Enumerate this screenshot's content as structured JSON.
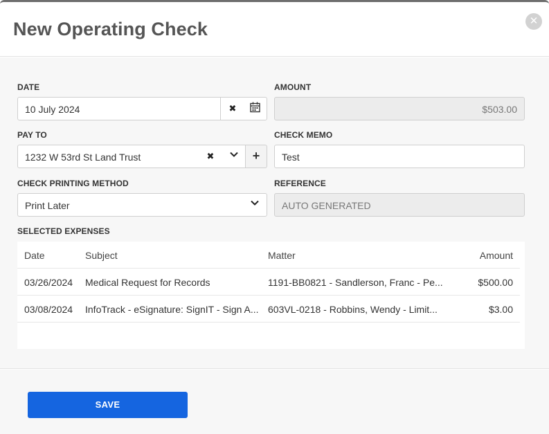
{
  "modal": {
    "title": "New Operating Check",
    "close_icon": "close-icon"
  },
  "form": {
    "date": {
      "label": "DATE",
      "value": "10 July 2024"
    },
    "amount": {
      "label": "AMOUNT",
      "value": "$503.00"
    },
    "pay_to": {
      "label": "PAY TO",
      "value": "1232 W 53rd St Land Trust"
    },
    "check_memo": {
      "label": "CHECK MEMO",
      "value": "Test"
    },
    "printing_method": {
      "label": "CHECK PRINTING METHOD",
      "value": "Print Later"
    },
    "reference": {
      "label": "REFERENCE",
      "value": "AUTO GENERATED"
    },
    "clear_glyph": "✖",
    "calendar_glyph": "📅",
    "chevron_glyph": "⌄",
    "plus_glyph": "+"
  },
  "expenses": {
    "label": "SELECTED EXPENSES",
    "columns": {
      "date": "Date",
      "subject": "Subject",
      "matter": "Matter",
      "amount": "Amount"
    },
    "rows": [
      {
        "date": "03/26/2024",
        "subject": "Medical Request for Records",
        "matter": "1191-BB0821 - Sandlerson, Franc - Pe...",
        "amount": "$500.00"
      },
      {
        "date": "03/08/2024",
        "subject": "InfoTrack - eSignature: SignIT - Sign A...",
        "matter": "603VL-0218 - Robbins, Wendy - Limit...",
        "amount": "$3.00"
      }
    ]
  },
  "footer": {
    "save_label": "SAVE"
  },
  "colors": {
    "primary": "#1565e0",
    "title": "#555555"
  }
}
